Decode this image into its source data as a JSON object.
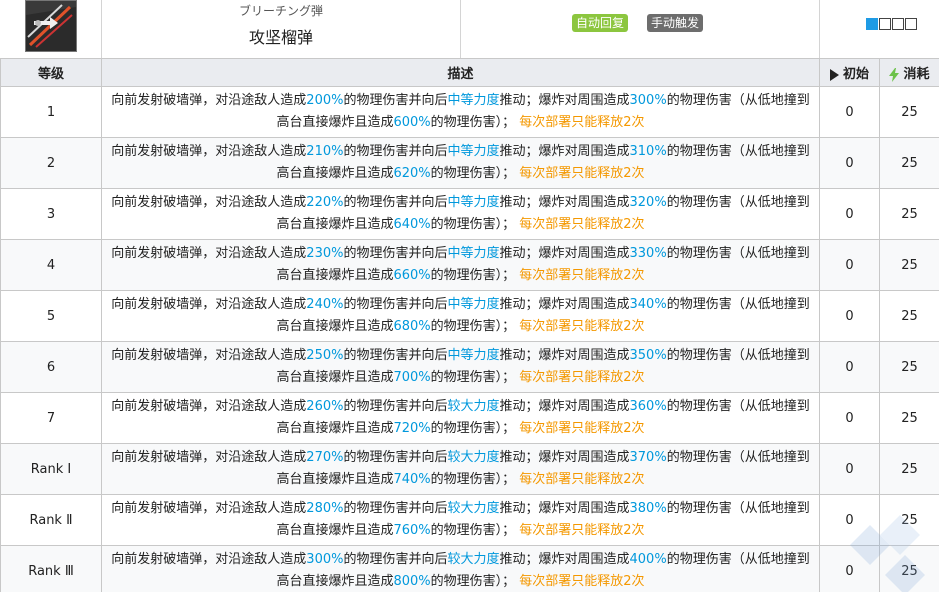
{
  "skill": {
    "icon": "breaching-grenade-icon",
    "name_jp": "ブリーチング弾",
    "name_cn": "攻坚榴弹",
    "tags": [
      "自动回复",
      "手动触发"
    ],
    "sp_squares": [
      true,
      false,
      false,
      false
    ]
  },
  "table": {
    "headers": {
      "level": "等级",
      "desc": "描述",
      "initial": "初始",
      "cost": "消耗"
    },
    "rows": [
      {
        "level": "1",
        "p1": "向前发射破墙弹，对沿途敌人造成",
        "a": "200%",
        "p2": "的物理伤害并向后",
        "force": "中等力度",
        "p3": "推动；爆炸对周围造成",
        "b": "300%",
        "p4": "的物理伤害（从低地撞到高台直接爆炸且造成",
        "c": "600%",
        "p5": "的物理伤害）；",
        "limit": "每次部署只能释放2次",
        "initial": "0",
        "cost": "25"
      },
      {
        "level": "2",
        "p1": "向前发射破墙弹，对沿途敌人造成",
        "a": "210%",
        "p2": "的物理伤害并向后",
        "force": "中等力度",
        "p3": "推动；爆炸对周围造成",
        "b": "310%",
        "p4": "的物理伤害（从低地撞到高台直接爆炸且造成",
        "c": "620%",
        "p5": "的物理伤害）；",
        "limit": "每次部署只能释放2次",
        "initial": "0",
        "cost": "25"
      },
      {
        "level": "3",
        "p1": "向前发射破墙弹，对沿途敌人造成",
        "a": "220%",
        "p2": "的物理伤害并向后",
        "force": "中等力度",
        "p3": "推动；爆炸对周围造成",
        "b": "320%",
        "p4": "的物理伤害（从低地撞到高台直接爆炸且造成",
        "c": "640%",
        "p5": "的物理伤害）；",
        "limit": "每次部署只能释放2次",
        "initial": "0",
        "cost": "25"
      },
      {
        "level": "4",
        "p1": "向前发射破墙弹，对沿途敌人造成",
        "a": "230%",
        "p2": "的物理伤害并向后",
        "force": "中等力度",
        "p3": "推动；爆炸对周围造成",
        "b": "330%",
        "p4": "的物理伤害（从低地撞到高台直接爆炸且造成",
        "c": "660%",
        "p5": "的物理伤害）；",
        "limit": "每次部署只能释放2次",
        "initial": "0",
        "cost": "25"
      },
      {
        "level": "5",
        "p1": "向前发射破墙弹，对沿途敌人造成",
        "a": "240%",
        "p2": "的物理伤害并向后",
        "force": "中等力度",
        "p3": "推动；爆炸对周围造成",
        "b": "340%",
        "p4": "的物理伤害（从低地撞到高台直接爆炸且造成",
        "c": "680%",
        "p5": "的物理伤害）；",
        "limit": "每次部署只能释放2次",
        "initial": "0",
        "cost": "25"
      },
      {
        "level": "6",
        "p1": "向前发射破墙弹，对沿途敌人造成",
        "a": "250%",
        "p2": "的物理伤害并向后",
        "force": "中等力度",
        "p3": "推动；爆炸对周围造成",
        "b": "350%",
        "p4": "的物理伤害（从低地撞到高台直接爆炸且造成",
        "c": "700%",
        "p5": "的物理伤害）；",
        "limit": "每次部署只能释放2次",
        "initial": "0",
        "cost": "25"
      },
      {
        "level": "7",
        "p1": "向前发射破墙弹，对沿途敌人造成",
        "a": "260%",
        "p2": "的物理伤害并向后",
        "force": "较大力度",
        "p3": "推动；爆炸对周围造成",
        "b": "360%",
        "p4": "的物理伤害（从低地撞到高台直接爆炸且造成",
        "c": "720%",
        "p5": "的物理伤害）；",
        "limit": "每次部署只能释放2次",
        "initial": "0",
        "cost": "25"
      },
      {
        "level": "Rank Ⅰ",
        "p1": "向前发射破墙弹，对沿途敌人造成",
        "a": "270%",
        "p2": "的物理伤害并向后",
        "force": "较大力度",
        "p3": "推动；爆炸对周围造成",
        "b": "370%",
        "p4": "的物理伤害（从低地撞到高台直接爆炸且造成",
        "c": "740%",
        "p5": "的物理伤害）；",
        "limit": "每次部署只能释放2次",
        "initial": "0",
        "cost": "25"
      },
      {
        "level": "Rank Ⅱ",
        "p1": "向前发射破墙弹，对沿途敌人造成",
        "a": "280%",
        "p2": "的物理伤害并向后",
        "force": "较大力度",
        "p3": "推动；爆炸对周围造成",
        "b": "380%",
        "p4": "的物理伤害（从低地撞到高台直接爆炸且造成",
        "c": "760%",
        "p5": "的物理伤害）；",
        "limit": "每次部署只能释放2次",
        "initial": "0",
        "cost": "25"
      },
      {
        "level": "Rank Ⅲ",
        "p1": "向前发射破墙弹，对沿途敌人造成",
        "a": "300%",
        "p2": "的物理伤害并向后",
        "force": "较大力度",
        "p3": "推动；爆炸对周围造成",
        "b": "400%",
        "p4": "的物理伤害（从低地撞到高台直接爆炸且造成",
        "c": "800%",
        "p5": "的物理伤害）；",
        "limit": "每次部署只能释放2次",
        "initial": "0",
        "cost": "25"
      }
    ]
  },
  "colors": {
    "highlight_blue": "#0098dc",
    "highlight_orange": "#f49800",
    "tag_green": "#8cc63f",
    "tag_gray": "#6d6d6d",
    "sp_active": "#1e9be5",
    "lightning": "#6cc24a"
  }
}
